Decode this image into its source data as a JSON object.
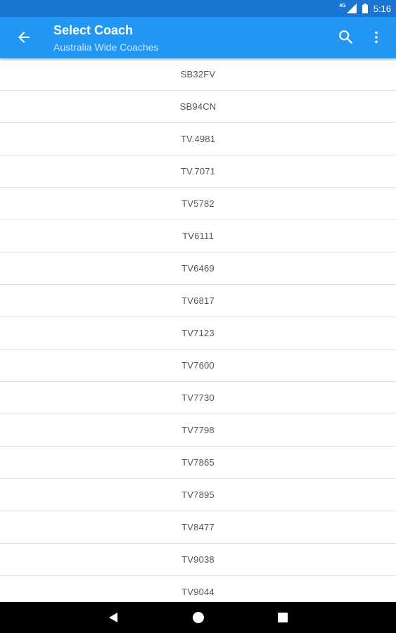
{
  "status_bar": {
    "network": "4G",
    "time": "5:16"
  },
  "app_bar": {
    "title": "Select Coach",
    "subtitle": "Australia Wide Coaches",
    "back_icon": "arrow-back-icon",
    "search_icon": "search-icon",
    "more_icon": "more-vert-icon"
  },
  "coaches": [
    "SB32FV",
    "SB94CN",
    "TV.4981",
    "TV.7071",
    "TV5782",
    "TV6111",
    "TV6469",
    "TV6817",
    "TV7123",
    "TV7600",
    "TV7730",
    "TV7798",
    "TV7865",
    "TV7895",
    "TV8477",
    "TV9038",
    "TV9044"
  ],
  "nav_bar": {
    "back_icon": "nav-back-icon",
    "home_icon": "nav-home-icon",
    "recent_icon": "nav-recent-icon"
  },
  "colors": {
    "status_bar": "#1976D2",
    "app_bar": "#2196F3",
    "row_text": "#555555",
    "divider": "#e3e3e3"
  }
}
